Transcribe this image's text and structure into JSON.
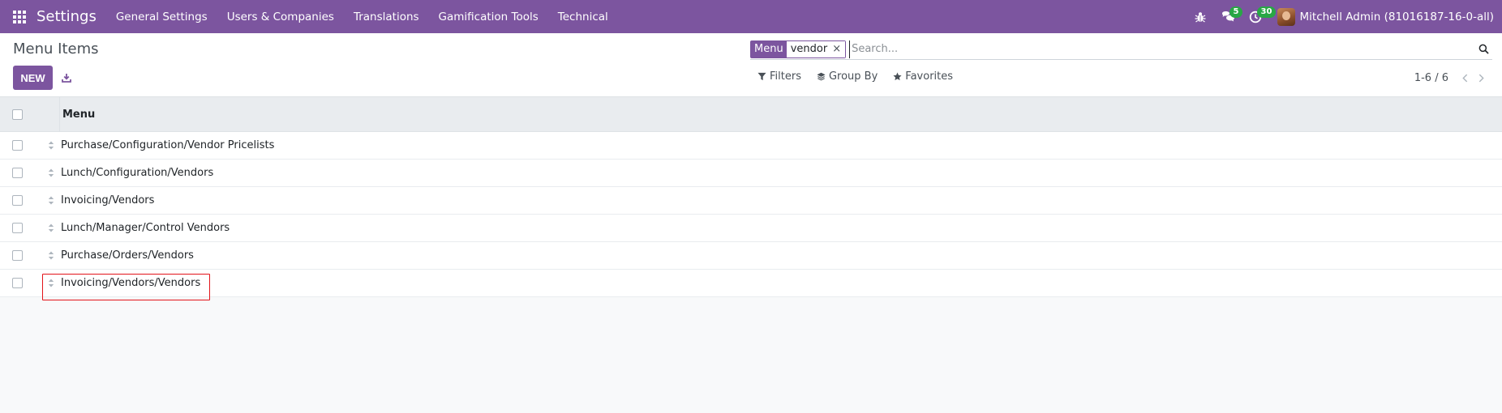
{
  "navbar": {
    "brand": "Settings",
    "menu": [
      "General Settings",
      "Users & Companies",
      "Translations",
      "Gamification Tools",
      "Technical"
    ],
    "messages_badge": "5",
    "activities_badge": "30",
    "user": "Mitchell Admin (81016187-16-0-all)",
    "icons": [
      "apps-icon",
      "bug-icon",
      "chat-icon",
      "clock-icon",
      "avatar"
    ]
  },
  "control_panel": {
    "title": "Menu Items",
    "new_label": "NEW",
    "search": {
      "facet_label": "Menu",
      "facet_value": "vendor",
      "facet_remove": "×",
      "placeholder": "Search..."
    },
    "filters_label": "Filters",
    "groupby_label": "Group By",
    "favorites_label": "Favorites",
    "pager": "1-6 / 6"
  },
  "list": {
    "column_header": "Menu",
    "rows": [
      "Purchase/Configuration/Vendor Pricelists",
      "Lunch/Configuration/Vendors",
      "Invoicing/Vendors",
      "Lunch/Manager/Control Vendors",
      "Purchase/Orders/Vendors",
      "Invoicing/Vendors/Vendors"
    ]
  },
  "colors": {
    "navbar": "#7c559f",
    "highlight": "#e3141a",
    "badge": "#28a745"
  }
}
